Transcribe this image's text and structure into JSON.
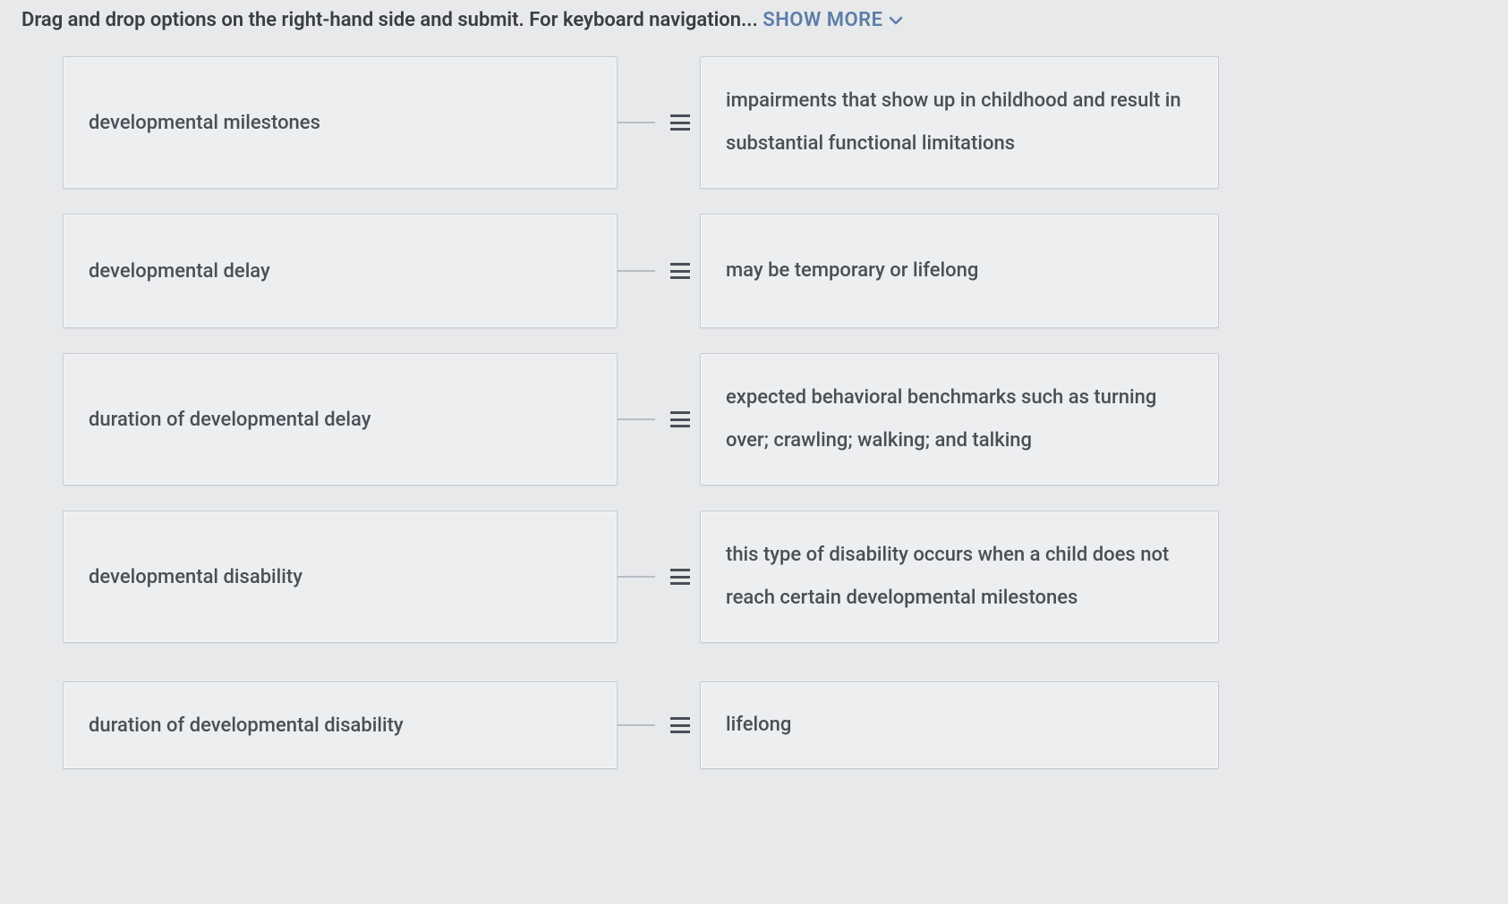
{
  "instructions": {
    "prefix": "Drag and drop options on the right-hand side and submit. For keyboard navigation... ",
    "show_more": "SHOW MORE"
  },
  "rows": [
    {
      "term": "developmental milestones",
      "definition": "impairments that show up in childhood and result in substantial functional limitations",
      "tall": true
    },
    {
      "term": "developmental delay",
      "definition": "may be temporary or lifelong",
      "tall": false
    },
    {
      "term": "duration of developmental delay",
      "definition": "expected behavioral benchmarks such as turning over; crawling; walking; and talking",
      "tall": true
    },
    {
      "term": "developmental disability",
      "definition": "this type of disability occurs when a child does not reach certain developmental milestones",
      "tall": true
    },
    {
      "term": "duration of developmental disability",
      "definition": "lifelong",
      "tall": false,
      "short": true
    }
  ]
}
